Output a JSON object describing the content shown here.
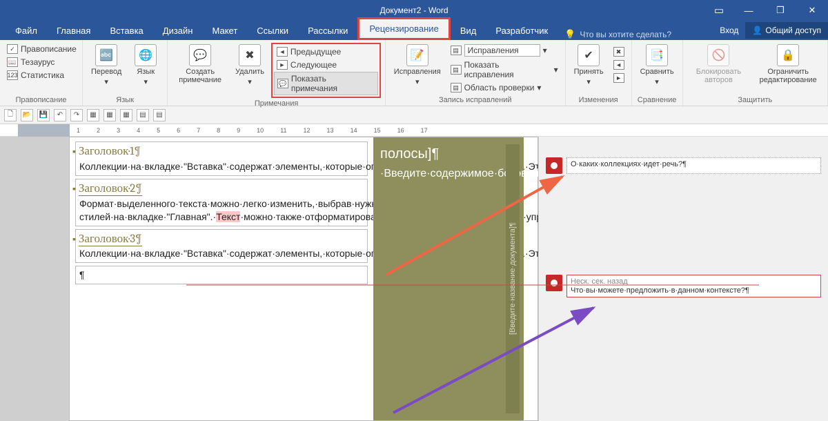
{
  "title": "Документ2 - Word",
  "win": {
    "restore": "❐",
    "min": "—",
    "close": "✕",
    "acc": "▭"
  },
  "menu": [
    "Файл",
    "Главная",
    "Вставка",
    "Дизайн",
    "Макет",
    "Ссылки",
    "Рассылки",
    "Рецензирование",
    "Вид",
    "Разработчик"
  ],
  "active_menu": 7,
  "tell_me": "Что вы хотите сделать?",
  "login": "Вход",
  "share": "Общий доступ",
  "ribbon": {
    "proofing": {
      "spell": "Правописание",
      "thesaurus": "Тезаурус",
      "stats": "Статистика",
      "label": "Правописание"
    },
    "lang": {
      "translate": "Перевод",
      "language": "Язык",
      "label": "Язык"
    },
    "comments": {
      "new": "Создать примечание",
      "del": "Удалить",
      "prev": "Предыдущее",
      "next": "Следующее",
      "show": "Показать примечания",
      "label": "Примечания"
    },
    "tracking": {
      "track": "Исправления",
      "display": "Исправления",
      "showmk": "Показать исправления",
      "pane": "Область проверки",
      "label": "Запись исправлений"
    },
    "changes": {
      "accept": "Принять",
      "label": "Изменения"
    },
    "compare": {
      "compare": "Сравнить",
      "label": "Сравнение"
    },
    "protect": {
      "block": "Блокировать авторов",
      "restrict": "Ограничить редактирование",
      "label": "Защитить"
    }
  },
  "ruler_ticks": [
    "1",
    "",
    "1",
    "2",
    "3",
    "4",
    "5",
    "6",
    "7",
    "8",
    "9",
    "10",
    "11",
    "12",
    "13",
    "14",
    "15",
    "16",
    "17"
  ],
  "doc": {
    "h1": "Заголовок·1¶",
    "p1": "Коллекции·на·вкладке·\"Вставка\"·содержат·элементы,·которые·определяют·общий·вид·документа.·Эти·коллекции·служат·для·вставки·в·документ·таблиц,·колонтитулов,·списков,·титульных·страниц·и·других·стандартных·блоков.¶",
    "h2": "Заголовок·2¶",
    "p2a": "Формат·выделенного·текста·можно·легко·изменить,·выбрав·нужный·вид·из·коллекции·экспресс-стилей·на·вкладке·\"Главная\".·",
    "p2hl": "Текст",
    "p2b": "·можно·также·отформатировать·с·помощью·других·элементов·управления·на·вкладке·\"Главная\".·¶",
    "h3": "Заголовок·3¶",
    "p3": "Коллекции·на·вкладке·\"Вставка\"·содержат·элементы,·которые·определяют·общий·вид·документа.·Эти·коллекции·служат·для·вставки·в·документ·таблиц,·колонтитулов,·списков,·титульных·страниц·и·других·стандартных·блоков.¶",
    "empty": "¶",
    "side_title": "полосы]¶",
    "side_body": "·Введите·содержимое·боковой·полосы.·Боковая·полоса·представляет·собой·независимое·дополнение·к·основному·документу.·Обычно·она·выровнена·по·левому·или·правому·краю·",
    "side_vert": "[Введите·название·документа]¶"
  },
  "comments": [
    {
      "time": "",
      "text": "О·каких·коллекциях·идет·речь?¶"
    },
    {
      "time": "Неск. сек. назад",
      "text": "Что·вы·можете·предложить·в·данном·контексте?¶"
    }
  ]
}
